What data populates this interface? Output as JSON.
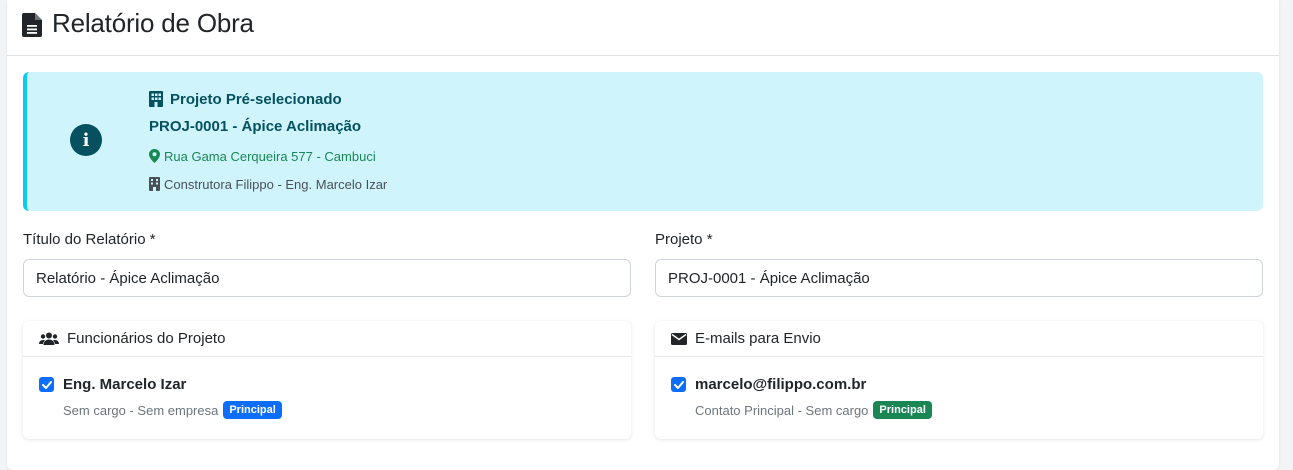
{
  "header": {
    "title": "Relatório de Obra"
  },
  "alert": {
    "heading": "Projeto Pré-selecionado",
    "project": "PROJ-0001 - Ápice Aclimação",
    "address": "Rua Gama Cerqueira 577 - Cambuci",
    "company": "Construtora Filippo - Eng. Marcelo Izar"
  },
  "form": {
    "title_label": "Título do Relatório *",
    "title_value": "Relatório - Ápice Aclimação",
    "project_label": "Projeto *",
    "project_value": "PROJ-0001 - Ápice Aclimação"
  },
  "employees_card": {
    "title": "Funcionários do Projeto",
    "items": [
      {
        "name": "Eng. Marcelo Izar",
        "checked": true,
        "subtitle": "Sem cargo - Sem empresa",
        "badge": "Principal"
      }
    ]
  },
  "emails_card": {
    "title": "E-mails para Envio",
    "items": [
      {
        "email": "marcelo@filippo.com.br",
        "checked": true,
        "subtitle": "Contato Principal - Sem cargo",
        "badge": "Principal"
      }
    ]
  },
  "colors": {
    "alert_bg": "#cff4fc",
    "alert_text": "#055160",
    "address_green": "#198754",
    "primary_blue": "#0d6efd",
    "badge_green": "#198754"
  }
}
